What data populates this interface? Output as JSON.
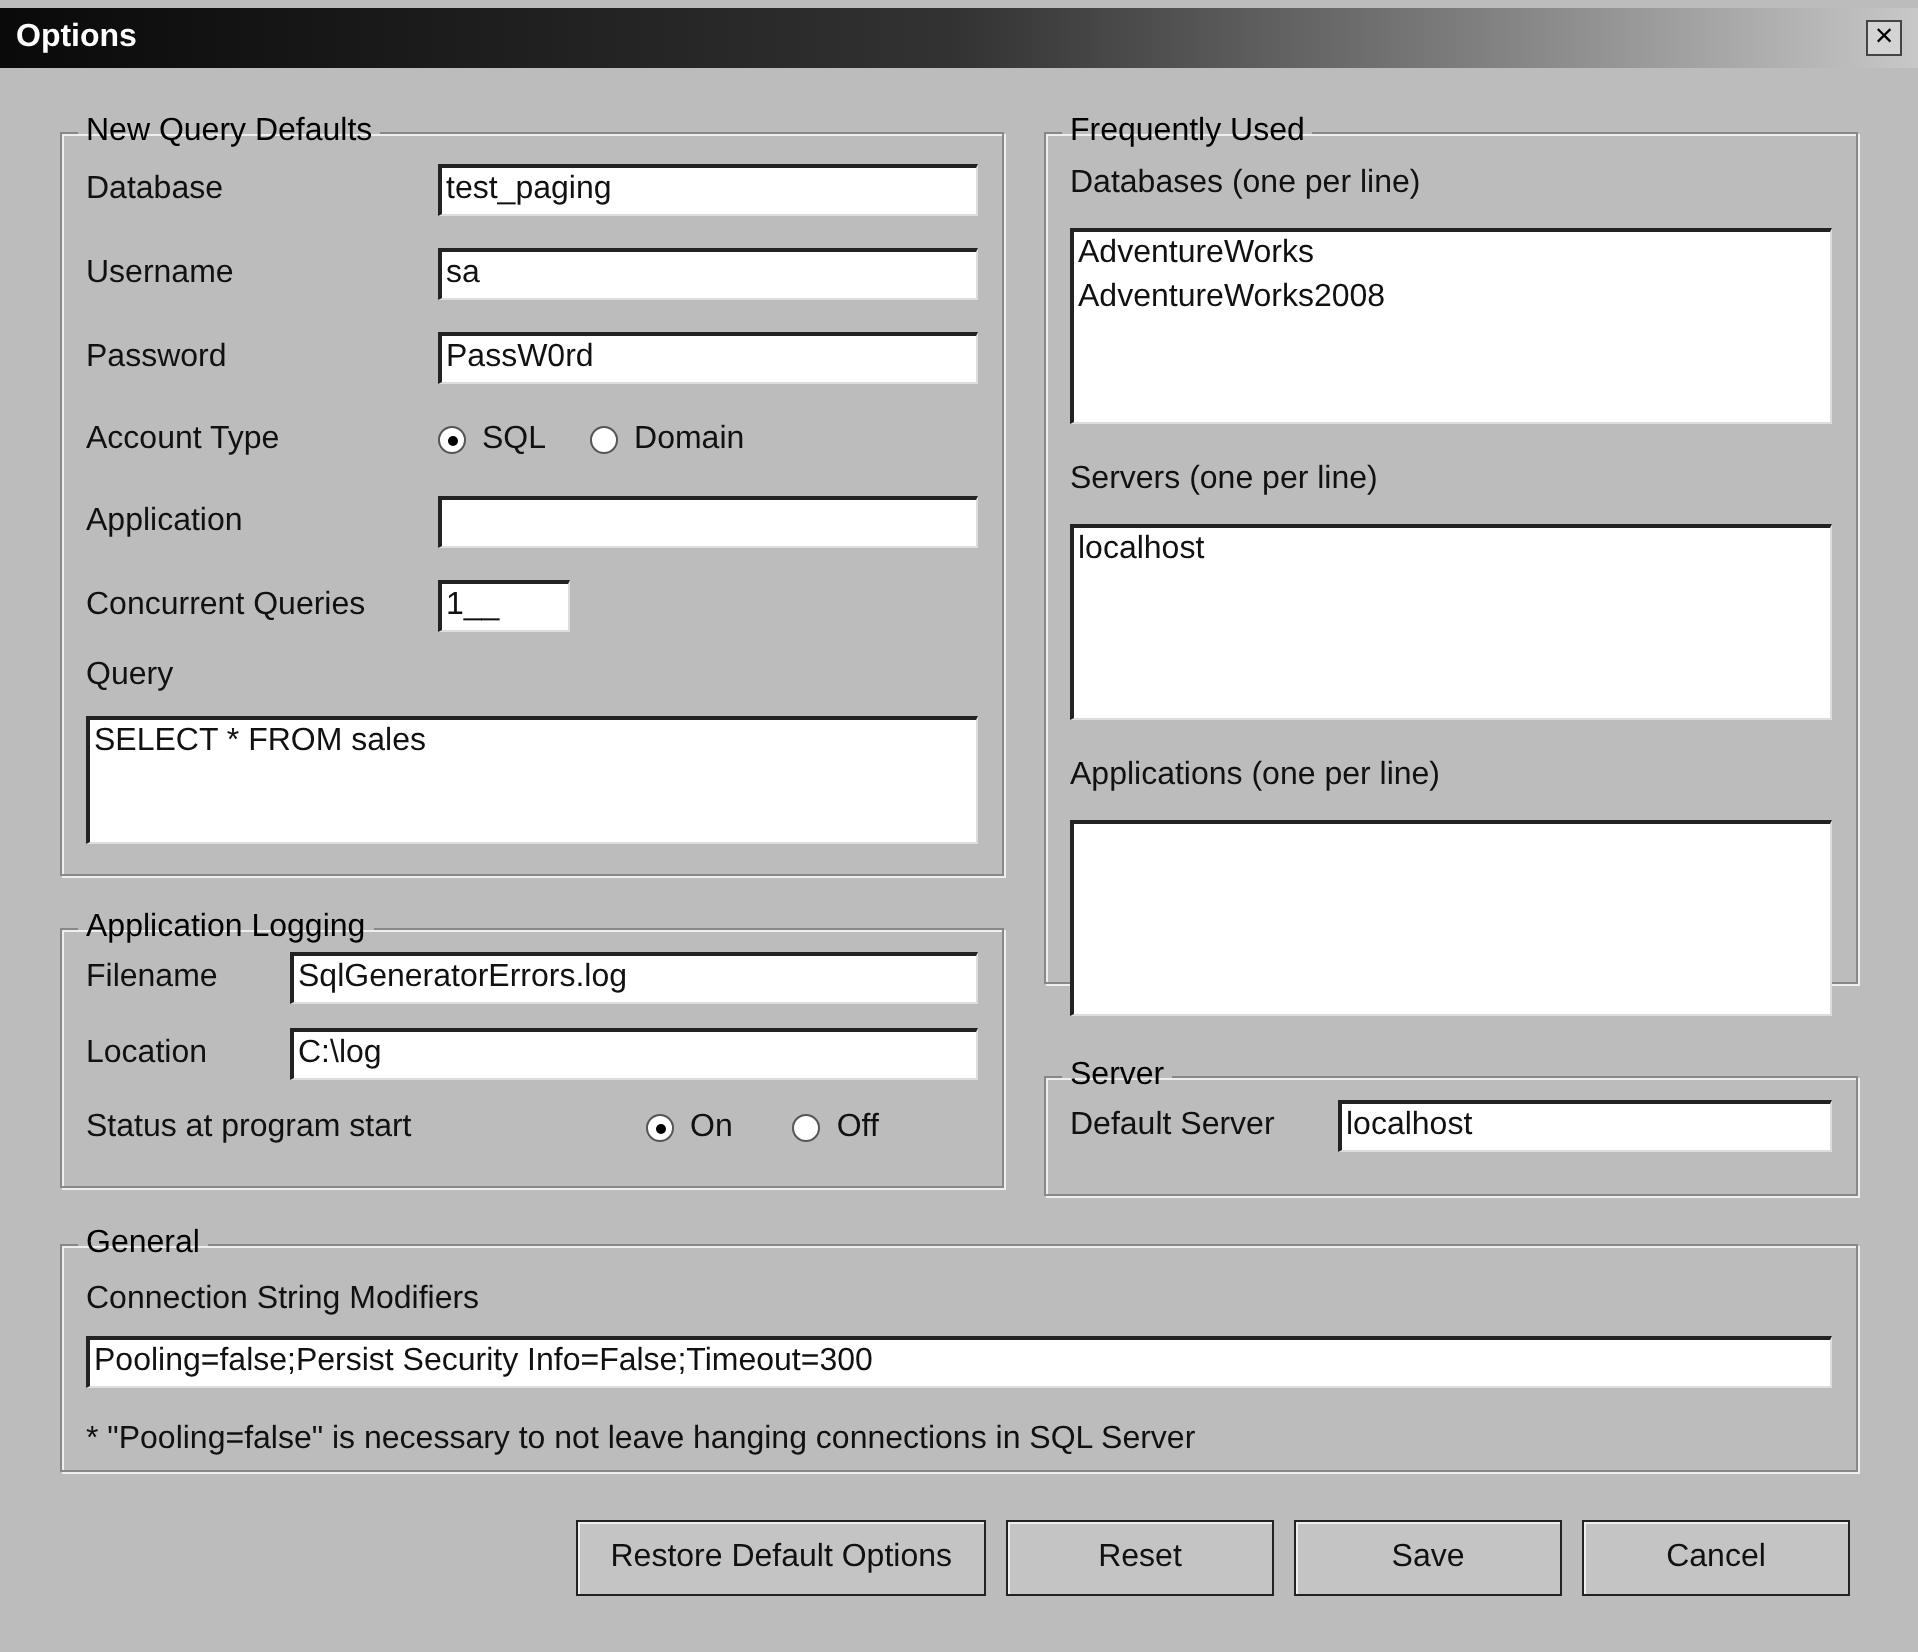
{
  "window": {
    "title": "Options",
    "close": "×"
  },
  "new_query_defaults": {
    "title": "New Query Defaults",
    "fields": [
      {
        "label": "Database",
        "value": "test_paging"
      },
      {
        "label": "Username",
        "value": "sa"
      },
      {
        "label": "Password",
        "value": "PassW0rd"
      }
    ],
    "account_type": {
      "label": "Account Type",
      "options": [
        {
          "label": "SQL",
          "selected": true
        },
        {
          "label": "Domain",
          "selected": false
        }
      ]
    },
    "application": {
      "label": "Application"
    },
    "concurrent_queries": {
      "label": "Concurrent Queries",
      "value": "1__"
    },
    "query": {
      "label": "Query",
      "value": "SELECT * FROM sales"
    }
  },
  "application_logging": {
    "title": "Application Logging",
    "fields": [
      {
        "label": "Filename",
        "value": "SqlGeneratorErrors.log"
      },
      {
        "label": "Location",
        "value": "C:\\log"
      }
    ],
    "status": {
      "label": "Status at program start",
      "options": [
        {
          "label": "On",
          "selected": true
        },
        {
          "label": "Off",
          "selected": false
        }
      ]
    }
  },
  "frequently_used": {
    "title": "Frequently Used",
    "lists": [
      {
        "label": "Databases (one per line)",
        "lines": [
          "AdventureWorks",
          "AdventureWorks2008"
        ]
      },
      {
        "label": "Servers (one per line)",
        "lines": [
          "localhost"
        ]
      },
      {
        "label": "Applications (one per line)"
      }
    ]
  },
  "server": {
    "title": "Server",
    "label": "Default Server",
    "value": "localhost"
  },
  "general": {
    "title": "General",
    "label": "Connection String Modifiers",
    "value": "Pooling=false;Persist Security Info=False;Timeout=300",
    "note": "* \"Pooling=false\" is necessary to not leave hanging connections in SQL Server"
  },
  "buttons": [
    "Restore Default Options",
    "Reset",
    "Save",
    "Cancel"
  ]
}
